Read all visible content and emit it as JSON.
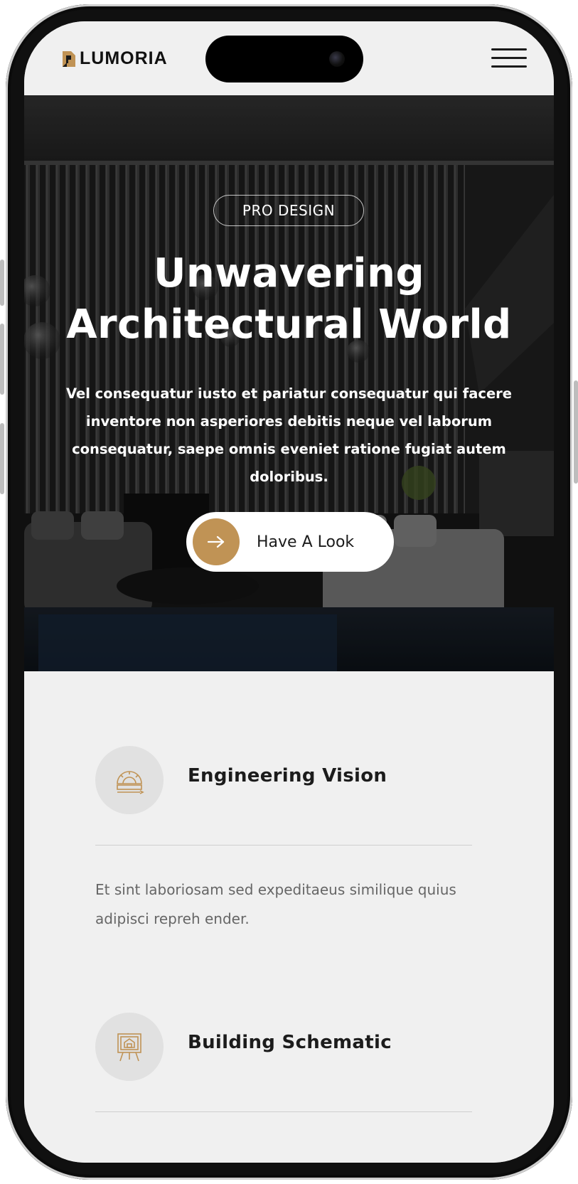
{
  "brand": {
    "name": "LUMORIA",
    "accent_color": "#c09355"
  },
  "header": {
    "menu_icon": "hamburger-menu-icon"
  },
  "hero": {
    "tag": "PRO DESIGN",
    "title_line1": "Unwavering",
    "title_line2": "Architectural World",
    "description": "Vel consequatur iusto et pariatur consequatur qui facere inventore non asperiores debitis neque vel laborum consequatur, saepe omnis eveniet ratione fugiat autem doloribus.",
    "cta_label": "Have A Look",
    "cta_icon": "arrow-right-icon"
  },
  "features": [
    {
      "title": "Engineering Vision",
      "text": "Et sint laboriosam sed expeditaeus similique quius adipisci repreh ender.",
      "icon": "protractor-ruler-icon"
    },
    {
      "title": "Building Schematic",
      "icon": "blueprint-easel-icon"
    }
  ]
}
